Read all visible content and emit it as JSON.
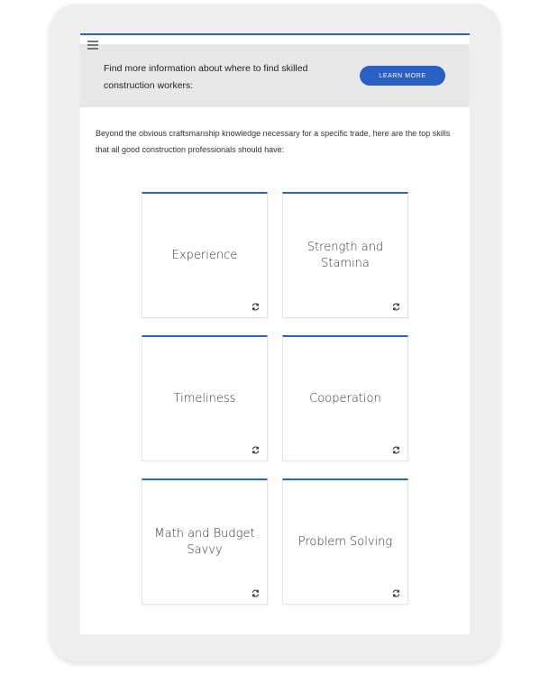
{
  "banner": {
    "text": "Find more information about where to find skilled construction workers:",
    "button_label": "LEARN MORE"
  },
  "intro": "Beyond the obvious craftsmanship knowledge necessary for a specific trade, here are the top skills that all good construction professionals should have:",
  "cards": [
    {
      "label": "Experience"
    },
    {
      "label": "Strength and Stamina"
    },
    {
      "label": "Timeliness"
    },
    {
      "label": "Cooperation"
    },
    {
      "label": "Math and Budget Savvy"
    },
    {
      "label": "Problem Solving"
    }
  ],
  "colors": {
    "accent": "#2d63c8",
    "button": "#2a5fc4",
    "banner_bg": "#e8e8e8",
    "device_frame": "#eeeeee"
  },
  "icons": {
    "menu": "hamburger-menu-icon",
    "card": "flip-rotate-icon"
  }
}
